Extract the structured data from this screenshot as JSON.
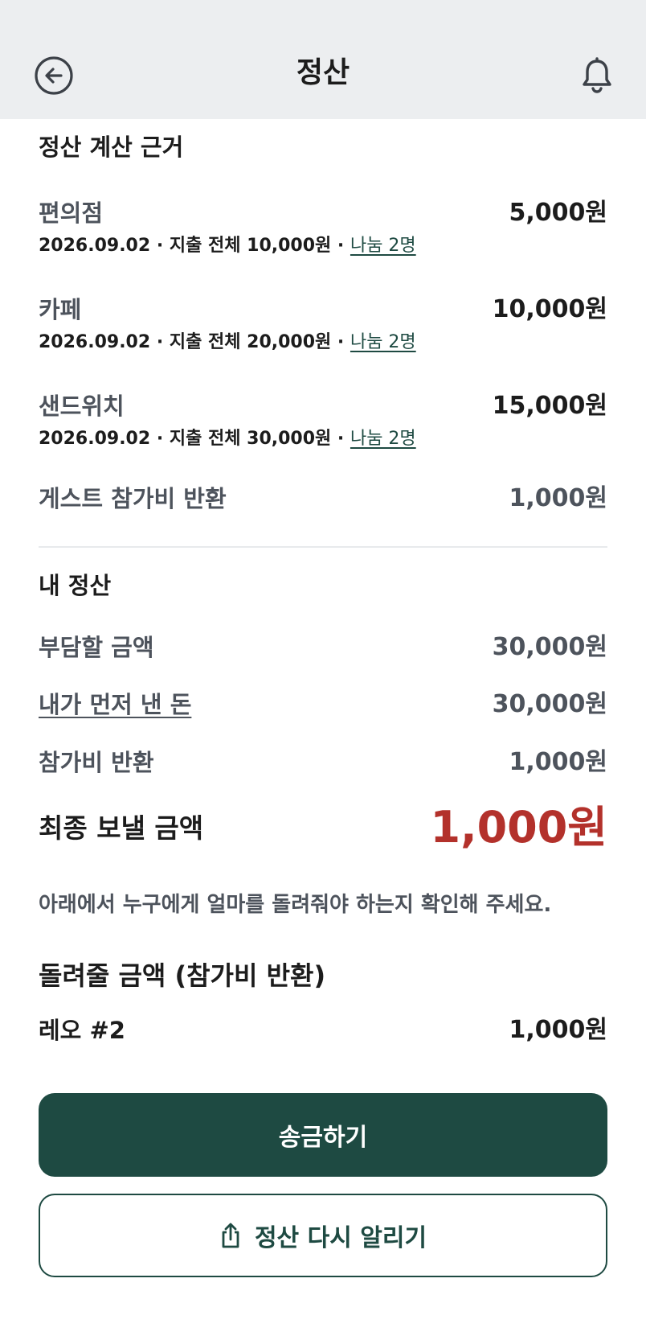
{
  "header": {
    "title": "정산",
    "back_icon": "back-arrow-circle-icon",
    "bell_icon": "bell-icon"
  },
  "basis": {
    "title": "정산 계산 근거",
    "items": [
      {
        "label": "편의점",
        "amount": "5,000원",
        "sub": "2026.09.02 · 지출 전체 10,000원 · ",
        "share": "나눔 2명"
      },
      {
        "label": "카페",
        "amount": "10,000원",
        "sub": "2026.09.02 · 지출 전체 20,000원 · ",
        "share": "나눔 2명"
      },
      {
        "label": "샌드위치",
        "amount": "15,000원",
        "sub": "2026.09.02 · 지출 전체 30,000원 · ",
        "share": "나눔 2명"
      }
    ],
    "guest_fee": {
      "label": "게스트 참가비 반환",
      "amount": "1,000원"
    }
  },
  "my_settlement": {
    "title": "내 정산",
    "burden": {
      "label": "부담할 금액",
      "amount": "30,000원"
    },
    "paid_first": {
      "label": "내가 먼저 낸 돈",
      "amount": "30,000원"
    },
    "fee_refund": {
      "label": "참가비 반환",
      "amount": "1,000원"
    },
    "final": {
      "label": "최종 보낼 금액",
      "amount": "1,000원"
    },
    "notice": "아래에서 누구에게 얼마를 돌려줘야 하는지 확인해 주세요."
  },
  "refund": {
    "title": "돌려줄 금액 (참가비 반환)",
    "items": [
      {
        "name": "레오 #2",
        "amount": "1,000원"
      }
    ]
  },
  "actions": {
    "send_label": "송금하기",
    "renotify_label": "정산 다시 알리기",
    "renotify_icon": "share-icon"
  },
  "colors": {
    "primary": "#1e4a42",
    "accent_red": "#b3312b",
    "header_bg": "#eceef0"
  }
}
